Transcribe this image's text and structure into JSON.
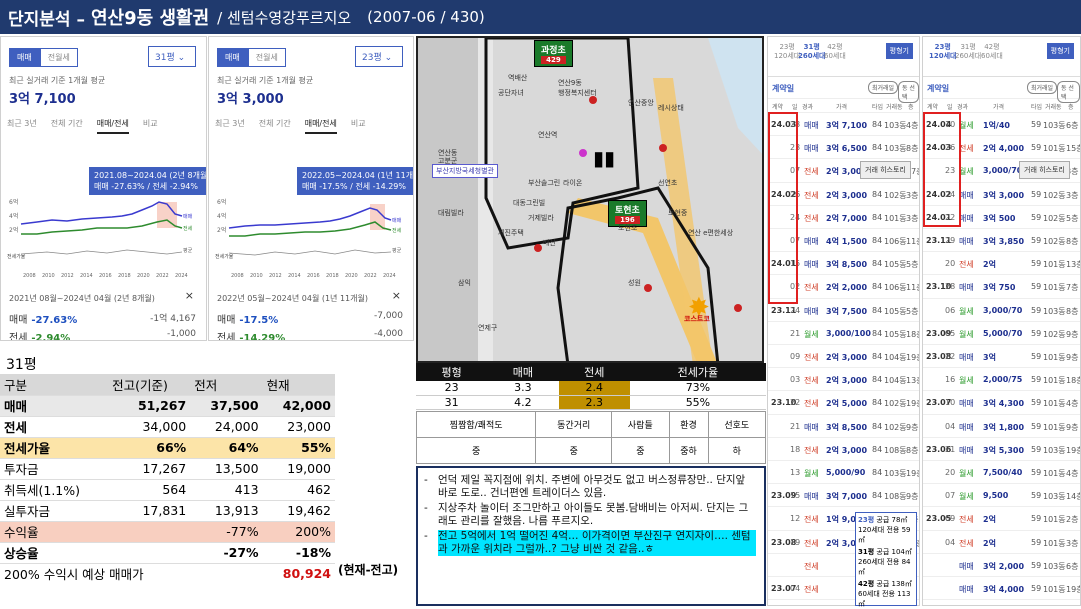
{
  "header": {
    "part1": "단지분석 –",
    "part2": "연산9동 생활권",
    "part3": "/ 센텀수영강푸르지오",
    "part4": "(2007-06 / 430)"
  },
  "panels": [
    {
      "tab_sale": "매매",
      "tab_jeonse": "전월세",
      "size": "31평",
      "subtitle": "최근 실거래 기준 1개월 평균",
      "price": "3억 7,100",
      "ptabs": [
        "최근 3년",
        "전체 기간",
        "매매/전세",
        "비교"
      ],
      "tip1": "2021.08~2024.04 (2년 8개월)",
      "tip2": "매매 -27.63% / 전세 -2.94%",
      "caption": "2021년 08월~2024년 04월 (2년 8개월)",
      "sale_label": "매매",
      "sale_pct": "-27.63%",
      "sale_amt": "-1억 4,167",
      "jeon_label": "전세",
      "jeon_pct": "-2.94%",
      "jeon_amt": "-1,000",
      "close": "×"
    },
    {
      "tab_sale": "매매",
      "tab_jeonse": "전월세",
      "size": "23평",
      "subtitle": "최근 실거래 기준 1개월 평균",
      "price": "3억 3,000",
      "ptabs": [
        "최근 3년",
        "전체 기간",
        "매매/전세",
        "비교"
      ],
      "tip1": "2022.05~2024.04 (1년 11개월)",
      "tip2": "매매 -17.5% / 전세 -14.29%",
      "caption": "2022년 05월~2024년 04월 (1년 11개월)",
      "sale_label": "매매",
      "sale_pct": "-17.5%",
      "sale_amt": "-7,000",
      "jeon_label": "전세",
      "jeon_pct": "-14.29%",
      "jeon_amt": "-4,000",
      "close": "×"
    }
  ],
  "chart_years": [
    "2008",
    "2010",
    "2012",
    "2014",
    "2016",
    "2018",
    "2020",
    "2022",
    "2024"
  ],
  "chart_yticks": [
    "6억",
    "4억",
    "2억"
  ],
  "chart_misc": {
    "jeonse_label": "전세가율",
    "sale": "매매",
    "jeonse": "전세",
    "avg": "평균"
  },
  "map": {
    "school1": "과정초",
    "school1_n": "429",
    "school2": "토현초",
    "school2_n": "196",
    "place": "부산지방국세청별관",
    "star": "코스트코",
    "labels": [
      "공단자녀",
      "역배산",
      "연산9동",
      "행정복지센터",
      "연산역",
      "연산동",
      "고분군",
      "연산중앙",
      "레시상태",
      "배산",
      "도현초",
      "토현중",
      "선연초",
      "연산 e편한세상",
      "거제빌라",
      "라이온",
      "대동그린빌",
      "대림빌라",
      "부산솔그린",
      "성원",
      "연제구",
      "삼익",
      "세진주택"
    ]
  },
  "compare": {
    "headers": [
      "평형",
      "매매",
      "전세",
      "전세가율"
    ],
    "rows": [
      [
        "23",
        "3.3",
        "2.4",
        "73%"
      ],
      [
        "31",
        "4.2",
        "2.3",
        "55%"
      ]
    ]
  },
  "eval": {
    "headers": [
      "찜짬함/쾌적도",
      "동간거리",
      "사람들",
      "환경",
      "선호도"
    ],
    "values": [
      "중",
      "중",
      "중",
      "중하",
      "하"
    ]
  },
  "notes": [
    "언덕 제일 꼭지점에 위치. 주변에 아무것도 없고 버스정류장만.. 단지앞 바로 도로.. 건너편엔 트레이더스 있음.",
    "지상주차 놀이터 조그만하고 아이들도 못봄.담배비는 아저씨. 단지는 그래도 관리를 잘했음. 나름 푸르지오.",
    "전고 5억에서 1억 떨어진 4억… 이가격이면 부산진구 연지자이…. 센텀과 가까운 위치라 그럴까..? 그냥 비싼 것 같음..ㅎ"
  ],
  "table": {
    "title": "31평",
    "headers": [
      "구분",
      "전고(기준)",
      "전저",
      "현재"
    ],
    "rows": [
      [
        "매매",
        "51,267",
        "37,500",
        "42,000"
      ],
      [
        "전세",
        "34,000",
        "24,000",
        "23,000"
      ],
      [
        "전세가율",
        "66%",
        "64%",
        "55%"
      ],
      [
        "투자금",
        "17,267",
        "13,500",
        "19,000"
      ],
      [
        "취득세(1.1%)",
        "564",
        "413",
        "462"
      ],
      [
        "실투자금",
        "17,831",
        "13,913",
        "19,462"
      ],
      [
        "수익율",
        "",
        "-77%",
        "200%"
      ],
      [
        "상승율",
        "",
        "-27%",
        "-18%"
      ]
    ],
    "extra": "(현재-전고)",
    "footer_label": "200% 수익시 예상 매매가",
    "footer_value": "80,924"
  },
  "list1": {
    "tabs": [
      [
        "23평",
        "120세대"
      ],
      [
        "31평",
        "260세대"
      ],
      [
        "42평",
        "60세대"
      ]
    ],
    "button": "평형기",
    "sub": "정렬일",
    "sub_b": "계약일",
    "pill1": "최거래일",
    "pill2": "동 선택",
    "cols": [
      "계약",
      "일",
      "경과",
      "가격",
      "타입",
      "거래동",
      "층"
    ],
    "rows": [
      [
        "24.03",
        "23",
        "매매",
        "3억 7,100",
        "84",
        "103동",
        "4층"
      ],
      [
        "",
        "23",
        "매매",
        "3억 6,500",
        "84",
        "103동",
        "8층"
      ],
      [
        "",
        "07",
        "전세",
        "2억 3,000",
        "84",
        "107동",
        "17층"
      ],
      [
        "24.02",
        "26",
        "전세",
        "2억 3,000",
        "84",
        "102동",
        "3층"
      ],
      [
        "",
        "24",
        "전세",
        "2억 7,000",
        "84",
        "101동",
        "3층"
      ],
      [
        "",
        "07",
        "매매",
        "4억 1,500",
        "84",
        "106동",
        "11층"
      ],
      [
        "24.01",
        "15",
        "매매",
        "3억 8,500",
        "84",
        "105동",
        "5층"
      ],
      [
        "",
        "02",
        "전세",
        "2억 2,000",
        "84",
        "106동",
        "11층"
      ],
      [
        "23.11",
        "24",
        "매매",
        "3억 7,500",
        "84",
        "105동",
        "5층"
      ],
      [
        "",
        "21",
        "월세",
        "3,000/100",
        "84",
        "105동",
        "18층"
      ],
      [
        "",
        "09",
        "전세",
        "2억 3,000",
        "84",
        "104동",
        "19층"
      ],
      [
        "",
        "03",
        "전세",
        "2억 3,000",
        "84",
        "104동",
        "13층"
      ],
      [
        "23.10",
        "22",
        "전세",
        "2억 5,000",
        "84",
        "102동",
        "19층"
      ],
      [
        "",
        "21",
        "매매",
        "3억 8,500",
        "84",
        "102동",
        "9층"
      ],
      [
        "",
        "18",
        "전세",
        "2억 3,000",
        "84",
        "108동",
        "8층"
      ],
      [
        "",
        "13",
        "월세",
        "5,000/90",
        "84",
        "103동",
        "19층"
      ],
      [
        "23.09",
        "15",
        "매매",
        "3억 7,000",
        "84",
        "108동",
        "9층"
      ],
      [
        "",
        "12",
        "전세",
        "1억 9,000",
        "84",
        "104동",
        "3층"
      ],
      [
        "23.08",
        "19",
        "전세",
        "2억 3,000",
        "84",
        "102동",
        "12층"
      ],
      [
        "",
        "",
        "전세",
        "",
        "84",
        "",
        ""
      ],
      [
        "23.07",
        "04",
        "전세",
        "",
        "84",
        "",
        ""
      ]
    ],
    "tooltip": "거래 히스토리"
  },
  "list2": {
    "tabs": [
      [
        "23평",
        "120세대"
      ],
      [
        "31평",
        "260세대"
      ],
      [
        "42평",
        "60세대"
      ]
    ],
    "button": "평형기",
    "sub": "정렬일",
    "sub_b": "계약일",
    "pill1": "최거래일",
    "pill2": "동 선택",
    "cols": [
      "계약",
      "일",
      "경과",
      "가격",
      "타입",
      "거래동",
      "층"
    ],
    "rows": [
      [
        "24.04",
        "10",
        "월세",
        "1억/40",
        "59",
        "103동",
        "6층"
      ],
      [
        "24.03",
        "26",
        "전세",
        "2억 4,000",
        "59",
        "101동",
        "15층"
      ],
      [
        "",
        "23",
        "월세",
        "3,000/70",
        "59",
        "101동",
        "8층"
      ],
      [
        "24.02",
        "24",
        "매매",
        "3억 3,000",
        "59",
        "102동",
        "3층"
      ],
      [
        "24.01",
        "22",
        "매매",
        "3억 500",
        "59",
        "102동",
        "5층"
      ],
      [
        "23.11",
        "29",
        "매매",
        "3억 3,850",
        "59",
        "102동",
        "8층"
      ],
      [
        "",
        "20",
        "전세",
        "2억",
        "59",
        "101동",
        "13층"
      ],
      [
        "23.10",
        "28",
        "매매",
        "3억 750",
        "59",
        "101동",
        "7층"
      ],
      [
        "",
        "06",
        "월세",
        "3,000/70",
        "59",
        "103동",
        "8층"
      ],
      [
        "23.09",
        "05",
        "월세",
        "5,000/70",
        "59",
        "102동",
        "9층"
      ],
      [
        "23.08",
        "22",
        "매매",
        "3억",
        "59",
        "101동",
        "9층"
      ],
      [
        "",
        "16",
        "월세",
        "2,000/75",
        "59",
        "101동",
        "18층"
      ],
      [
        "23.07",
        "10",
        "매매",
        "3억 4,300",
        "59",
        "101동",
        "4층"
      ],
      [
        "",
        "04",
        "매매",
        "3억 1,800",
        "59",
        "101동",
        "9층"
      ],
      [
        "23.06",
        "21",
        "매매",
        "3억 5,300",
        "59",
        "103동",
        "19층"
      ],
      [
        "",
        "20",
        "월세",
        "7,500/40",
        "59",
        "101동",
        "4층"
      ],
      [
        "",
        "07",
        "월세",
        "9,500",
        "59",
        "103동",
        "14층"
      ],
      [
        "23.05",
        "09",
        "전세",
        "2억",
        "59",
        "101동",
        "2층"
      ],
      [
        "",
        "04",
        "전세",
        "2억",
        "59",
        "101동",
        "3층"
      ],
      [
        "",
        "",
        "매매",
        "3억 2,000",
        "59",
        "103동",
        "6층"
      ],
      [
        "",
        "",
        "매매",
        "3억 4,000",
        "59",
        "101동",
        "19층"
      ]
    ],
    "tooltip": "거래 히스토리"
  },
  "popup": {
    "a": "23평",
    "a1": "공급 78㎡",
    "a2": "120세대",
    "a3": "전용 59㎡",
    "b": "31평",
    "b1": "공급 104㎡",
    "b2": "260세대",
    "b3": "전용 84㎡",
    "c": "42평",
    "c1": "공급 138㎡",
    "c2": "60세대",
    "c3": "전용 113㎡"
  }
}
